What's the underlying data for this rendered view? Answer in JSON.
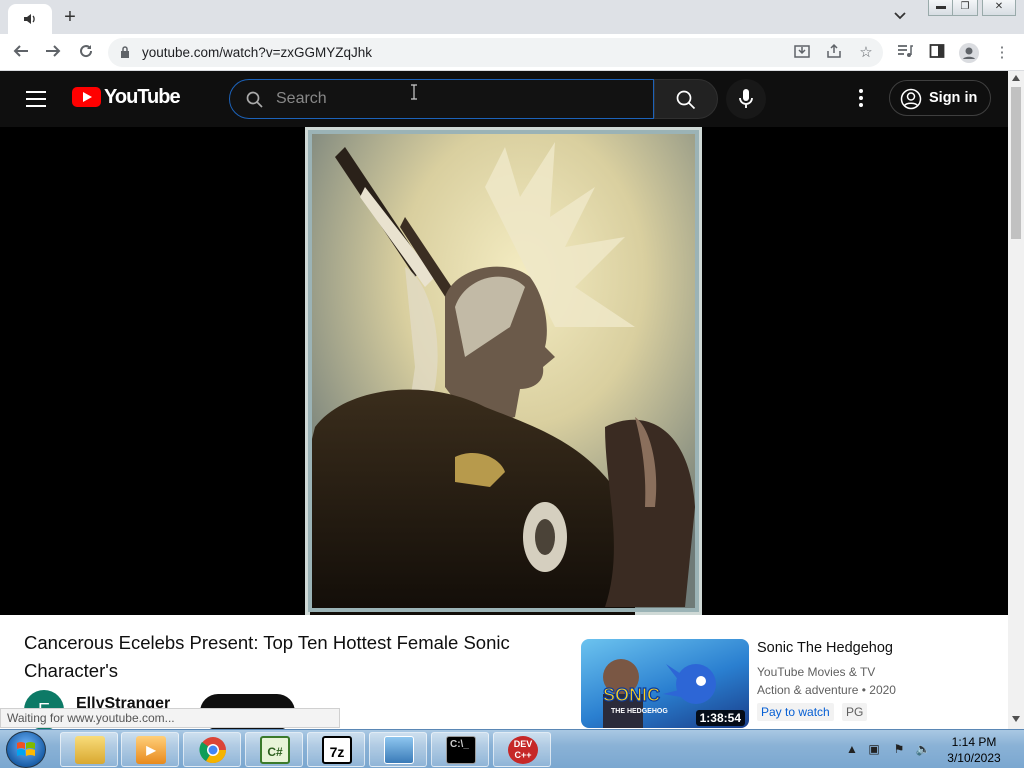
{
  "browser": {
    "url": "youtube.com/watch?v=zxGGMYZqJhk",
    "new_tab_label": "+",
    "status_text": "Waiting for www.youtube.com..."
  },
  "youtube": {
    "logo_text": "YouTube",
    "search_placeholder": "Search",
    "sign_in_label": "Sign in",
    "video_title": "Cancerous Ecelebs Present: Top Ten Hottest Female Sonic Character's",
    "channel_name": "EllyStranger",
    "recommendation": {
      "title": "Sonic The Hedgehog",
      "channel": "YouTube Movies & TV",
      "meta": "Action & adventure • 2020",
      "pay_label": "Pay to watch",
      "rating": "PG",
      "duration": "1:38:54"
    }
  },
  "taskbar": {
    "apps": [
      "file-explorer",
      "media-player",
      "chrome",
      "csharp",
      "7zip",
      "photo-viewer",
      "cmd",
      "devcpp"
    ],
    "clock_time": "1:14 PM",
    "clock_date": "3/10/2023"
  },
  "colors": {
    "yt_red": "#ff0000",
    "masthead_bg": "#0f0f0f",
    "taskbar": "#8ab2d6"
  }
}
